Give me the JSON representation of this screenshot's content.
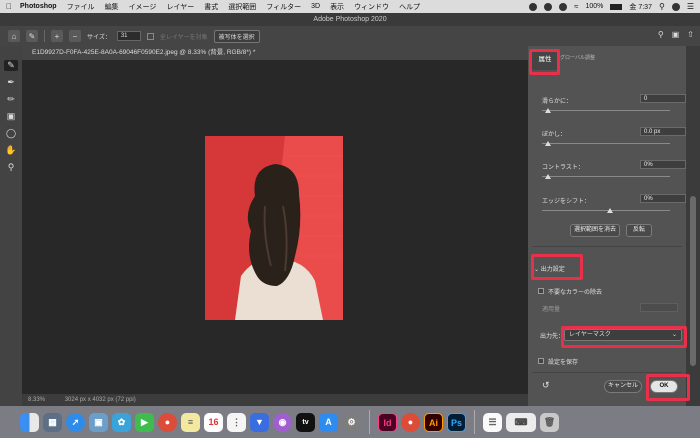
{
  "menubar": {
    "app": "Photoshop",
    "items": [
      "ファイル",
      "編集",
      "イメージ",
      "レイヤー",
      "書式",
      "選択範囲",
      "フィルター",
      "3D",
      "表示",
      "ウィンドウ",
      "ヘルプ"
    ],
    "battery": "100%",
    "time": "金 7:37"
  },
  "window": {
    "title": "Adobe Photoshop 2020"
  },
  "options": {
    "size_label": "サイズ：",
    "size_value": "31",
    "sample_all": "全レイヤーを対象",
    "select_subject": "被写体を選択"
  },
  "document": {
    "tab": "E1D9927D-F0FA-425E-8A0A-69046F0590E2.jpeg @ 8.33% (背景, RGB/8*) *",
    "zoom": "8.33%",
    "dimensions": "3024 px x 4032 px (72 ppi)"
  },
  "panel": {
    "tab_label": "属性",
    "tab_tail": "グローバル調整",
    "smooth": {
      "label": "滑らかに：",
      "value": "0"
    },
    "feather": {
      "label": "ぼかし：",
      "value": "0.0 px"
    },
    "contrast": {
      "label": "コントラスト：",
      "value": "0%"
    },
    "shift_edge": {
      "label": "エッジをシフト：",
      "value": "0%"
    },
    "clear_selection": "選択範囲を消去",
    "invert": "反転",
    "output_section": "出力設定",
    "decontaminate": "不要なカラーの除去",
    "amount_label": "適用量",
    "output_to_label": "出力先：",
    "output_to_value": "レイヤーマスク",
    "remember": "設定を保存",
    "cancel": "キャンセル",
    "ok": "OK"
  },
  "colors": {
    "highlight": "#e8304a",
    "canvas_image": "#e34040"
  },
  "dock": {
    "apps": [
      "finder",
      "launchpad",
      "safari",
      "preview",
      "photos",
      "facetime",
      "chrome",
      "notes",
      "calendar",
      "reminders",
      "keynote",
      "podcasts",
      "appletv",
      "appstore",
      "system-preferences",
      "indesign",
      "chrome",
      "illustrator",
      "photoshop",
      "textedit",
      "keyboard",
      "trash"
    ],
    "calendar_day": "16",
    "indesign": "Id",
    "illustrator": "Ai",
    "photoshop": "Ps",
    "appletv": "tv"
  }
}
